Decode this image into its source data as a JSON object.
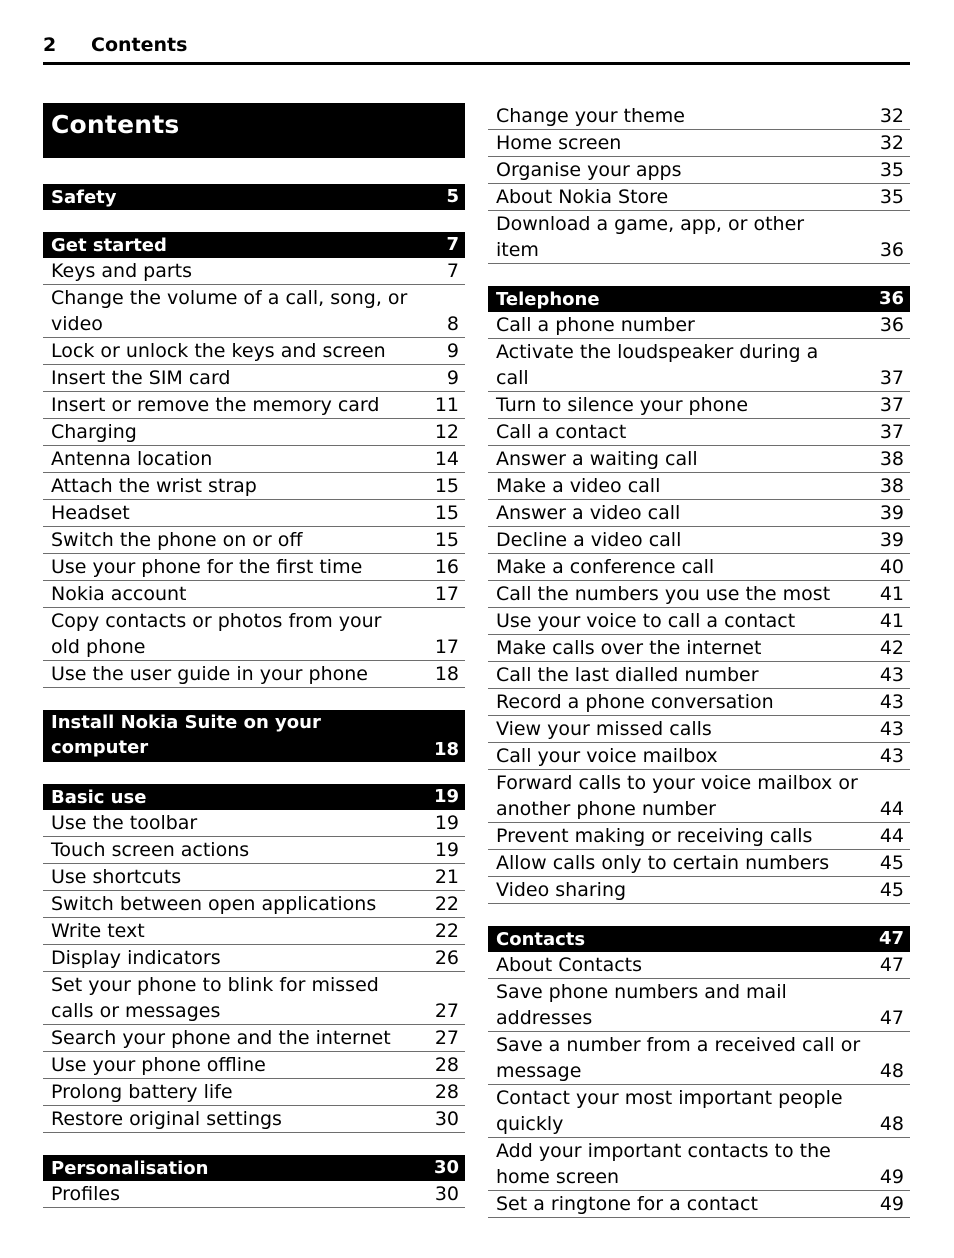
{
  "header": {
    "folio": "2",
    "running_title": "Contents"
  },
  "toc_title": "Contents",
  "left_column": [
    {
      "kind": "section",
      "label": "Safety",
      "page": "5"
    },
    {
      "kind": "gap"
    },
    {
      "kind": "section",
      "label": "Get started",
      "page": "7"
    },
    {
      "kind": "entry",
      "label": "Keys and parts",
      "page": "7"
    },
    {
      "kind": "entry",
      "label": "Change the volume of a call, song, or\nvideo",
      "page": "8"
    },
    {
      "kind": "entry",
      "label": "Lock or unlock the keys and screen",
      "page": "9"
    },
    {
      "kind": "entry",
      "label": "Insert the SIM card",
      "page": "9"
    },
    {
      "kind": "entry",
      "label": "Insert or remove the memory card",
      "page": "11"
    },
    {
      "kind": "entry",
      "label": "Charging",
      "page": "12"
    },
    {
      "kind": "entry",
      "label": "Antenna location",
      "page": "14"
    },
    {
      "kind": "entry",
      "label": "Attach the wrist strap",
      "page": "15"
    },
    {
      "kind": "entry",
      "label": "Headset",
      "page": "15"
    },
    {
      "kind": "entry",
      "label": "Switch the phone on or off",
      "page": "15"
    },
    {
      "kind": "entry",
      "label": "Use your phone for the first time",
      "page": "16"
    },
    {
      "kind": "entry",
      "label": "Nokia account",
      "page": "17"
    },
    {
      "kind": "entry",
      "label": "Copy contacts or photos from your\nold phone",
      "page": "17"
    },
    {
      "kind": "entry",
      "label": "Use the user guide in your phone",
      "page": "18"
    },
    {
      "kind": "gap"
    },
    {
      "kind": "section2",
      "label": "Install Nokia Suite on your\ncomputer",
      "page": "18"
    },
    {
      "kind": "gap"
    },
    {
      "kind": "section",
      "label": "Basic use",
      "page": "19"
    },
    {
      "kind": "entry",
      "label": "Use the toolbar",
      "page": "19"
    },
    {
      "kind": "entry",
      "label": "Touch screen actions",
      "page": "19"
    },
    {
      "kind": "entry",
      "label": "Use shortcuts",
      "page": "21"
    },
    {
      "kind": "entry",
      "label": "Switch between open applications",
      "page": "22"
    },
    {
      "kind": "entry",
      "label": "Write text",
      "page": "22"
    },
    {
      "kind": "entry",
      "label": "Display indicators",
      "page": "26"
    },
    {
      "kind": "entry",
      "label": "Set your phone to blink for missed\ncalls or messages",
      "page": "27"
    },
    {
      "kind": "entry",
      "label": "Search your phone and the internet",
      "page": "27"
    },
    {
      "kind": "entry",
      "label": "Use your phone offline",
      "page": "28"
    },
    {
      "kind": "entry",
      "label": "Prolong battery life",
      "page": "28"
    },
    {
      "kind": "entry",
      "label": "Restore original settings",
      "page": "30"
    },
    {
      "kind": "gap"
    },
    {
      "kind": "section",
      "label": "Personalisation",
      "page": "30"
    },
    {
      "kind": "entry",
      "label": "Profiles",
      "page": "30"
    }
  ],
  "right_column": [
    {
      "kind": "entry",
      "label": "Change your theme",
      "page": "32"
    },
    {
      "kind": "entry",
      "label": "Home screen",
      "page": "32"
    },
    {
      "kind": "entry",
      "label": "Organise your apps",
      "page": "35"
    },
    {
      "kind": "entry",
      "label": "About Nokia Store",
      "page": "35"
    },
    {
      "kind": "entry",
      "label": "Download a game, app, or other\nitem",
      "page": "36"
    },
    {
      "kind": "gap"
    },
    {
      "kind": "section",
      "label": "Telephone",
      "page": "36"
    },
    {
      "kind": "entry",
      "label": "Call a phone number",
      "page": "36"
    },
    {
      "kind": "entry",
      "label": "Activate the loudspeaker during a\ncall",
      "page": "37"
    },
    {
      "kind": "entry",
      "label": "Turn to silence your phone",
      "page": "37"
    },
    {
      "kind": "entry",
      "label": "Call a contact",
      "page": "37"
    },
    {
      "kind": "entry",
      "label": "Answer a waiting call",
      "page": "38"
    },
    {
      "kind": "entry",
      "label": "Make a video call",
      "page": "38"
    },
    {
      "kind": "entry",
      "label": "Answer a video call",
      "page": "39"
    },
    {
      "kind": "entry",
      "label": "Decline a video call",
      "page": "39"
    },
    {
      "kind": "entry",
      "label": "Make a conference call",
      "page": "40"
    },
    {
      "kind": "entry",
      "label": "Call the numbers you use the most",
      "page": "41"
    },
    {
      "kind": "entry",
      "label": "Use your voice to call a contact",
      "page": "41"
    },
    {
      "kind": "entry",
      "label": "Make calls over the internet",
      "page": "42"
    },
    {
      "kind": "entry",
      "label": "Call the last dialled number",
      "page": "43"
    },
    {
      "kind": "entry",
      "label": "Record a phone conversation",
      "page": "43"
    },
    {
      "kind": "entry",
      "label": "View your missed calls",
      "page": "43"
    },
    {
      "kind": "entry",
      "label": "Call your voice mailbox",
      "page": "43"
    },
    {
      "kind": "entry",
      "label": "Forward calls to your voice mailbox or\nanother phone number",
      "page": "44"
    },
    {
      "kind": "entry",
      "label": "Prevent making or receiving calls",
      "page": "44"
    },
    {
      "kind": "entry",
      "label": "Allow calls only to certain numbers",
      "page": "45"
    },
    {
      "kind": "entry",
      "label": "Video sharing",
      "page": "45"
    },
    {
      "kind": "gap"
    },
    {
      "kind": "section",
      "label": "Contacts",
      "page": "47"
    },
    {
      "kind": "entry",
      "label": "About Contacts",
      "page": "47"
    },
    {
      "kind": "entry",
      "label": "Save phone numbers and mail\naddresses",
      "page": "47"
    },
    {
      "kind": "entry",
      "label": "Save a number from a received call or\nmessage",
      "page": "48"
    },
    {
      "kind": "entry",
      "label": "Contact your most important people\nquickly",
      "page": "48"
    },
    {
      "kind": "entry",
      "label": "Add your important contacts to the\nhome screen",
      "page": "49"
    },
    {
      "kind": "entry",
      "label": "Set a ringtone for a contact",
      "page": "49"
    }
  ],
  "colors": {
    "section_bar_bg": "#000000",
    "section_bar_text": "#ffffff",
    "rule": "#6e6e6e",
    "header_rule": "#000000",
    "body_text": "#000000"
  }
}
